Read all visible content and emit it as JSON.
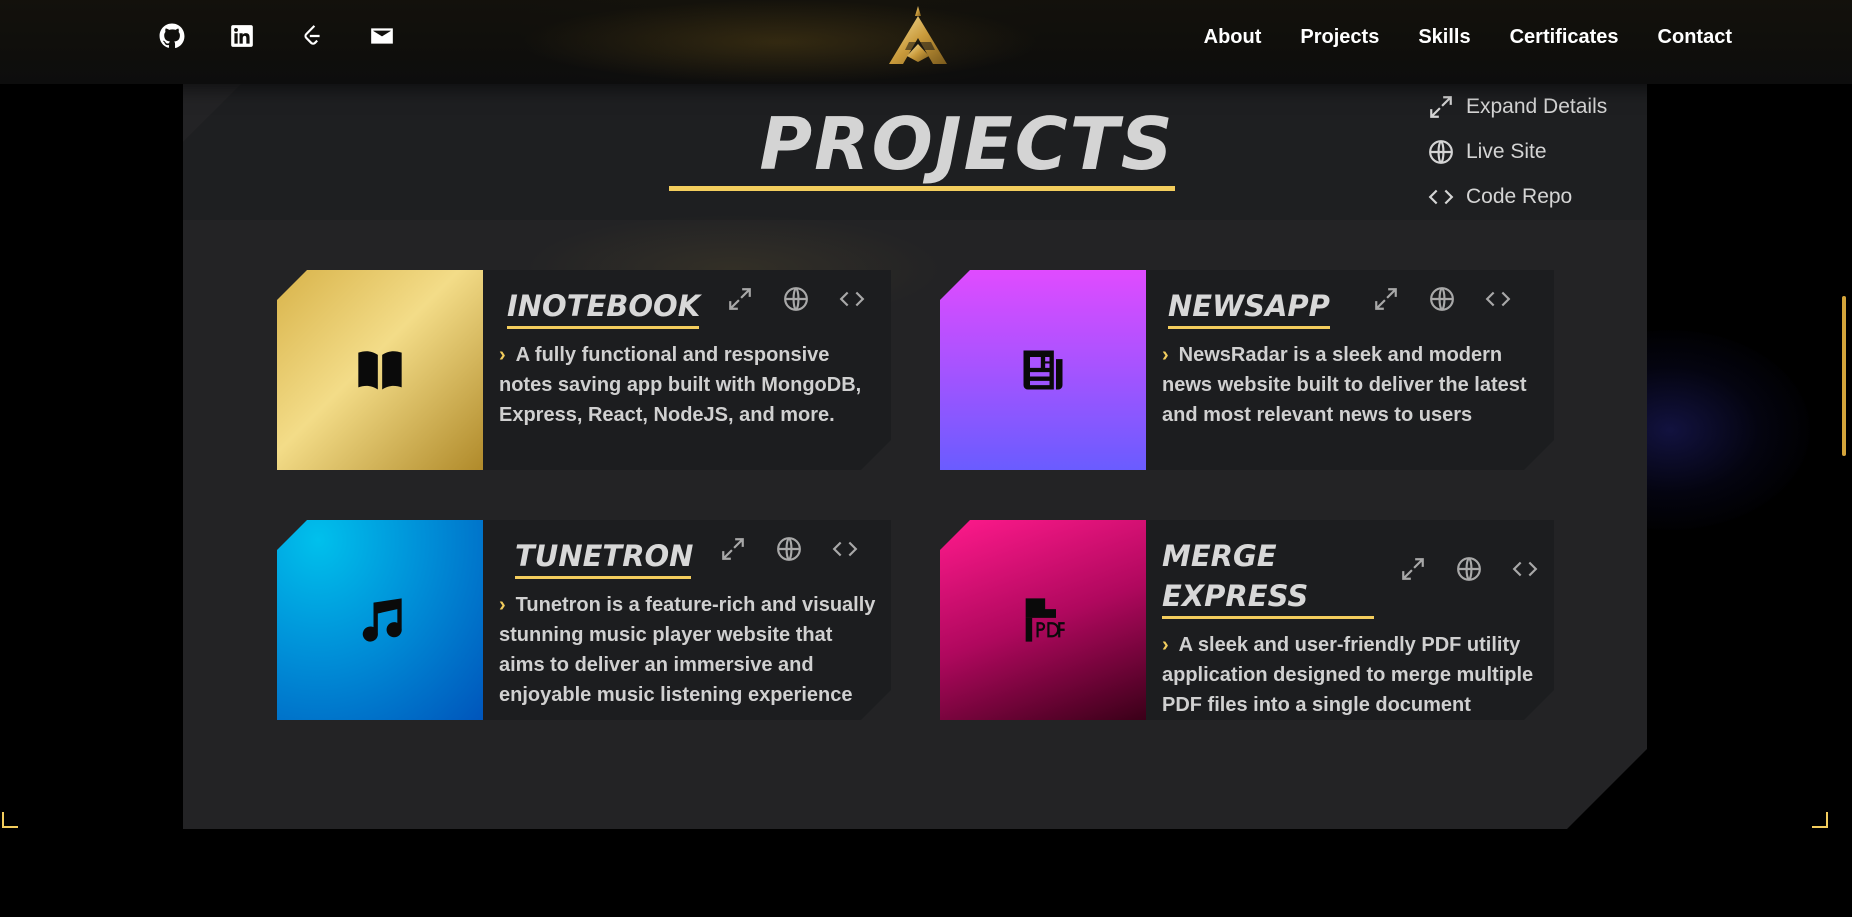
{
  "navbar": {
    "socials": [
      {
        "icon": "github-icon"
      },
      {
        "icon": "linkedin-icon"
      },
      {
        "icon": "leetcode-icon"
      },
      {
        "icon": "mail-icon"
      }
    ],
    "links": [
      "About",
      "Projects",
      "Skills",
      "Certificates",
      "Contact"
    ]
  },
  "section": {
    "title": "PROJECTS",
    "legend": [
      {
        "icon": "expand-icon",
        "label": "Expand Details"
      },
      {
        "icon": "globe-icon",
        "label": "Live Site"
      },
      {
        "icon": "code-icon",
        "label": "Code Repo"
      }
    ]
  },
  "projects": [
    {
      "title": "INOTEBOOK",
      "icon": "book-icon",
      "gradient": [
        "#b08a2a",
        "#f3dc88",
        "#d8b34a"
      ],
      "description": "A fully functional and responsive notes saving app built with MongoDB, Express, React, NodeJS, and more."
    },
    {
      "title": "NEWSAPP",
      "icon": "newspaper-icon",
      "gradient": [
        "#e04bff",
        "#6a5cff"
      ],
      "description": "NewsRadar is a sleek and modern news website built to deliver the latest and most relevant news to users"
    },
    {
      "title": "TUNETRON",
      "icon": "music-icon",
      "gradient": [
        "#00b8e8",
        "#0066cc"
      ],
      "description": "Tunetron is a feature-rich and visually stunning music player website that aims to deliver an immersive and enjoyable music listening experience"
    },
    {
      "title": "MERGE EXPRESS",
      "title_line1": "MERGE",
      "title_line2": "EXPRESS",
      "icon": "pdf-file-icon",
      "gradient": [
        "#ff1a8c",
        "#3a0018"
      ],
      "description": "A sleek and user-friendly PDF utility application designed to merge multiple PDF files into a single document"
    }
  ],
  "colors": {
    "accent": "#f3cd5d",
    "panel": "#232325",
    "card": "#1c1d1f"
  }
}
